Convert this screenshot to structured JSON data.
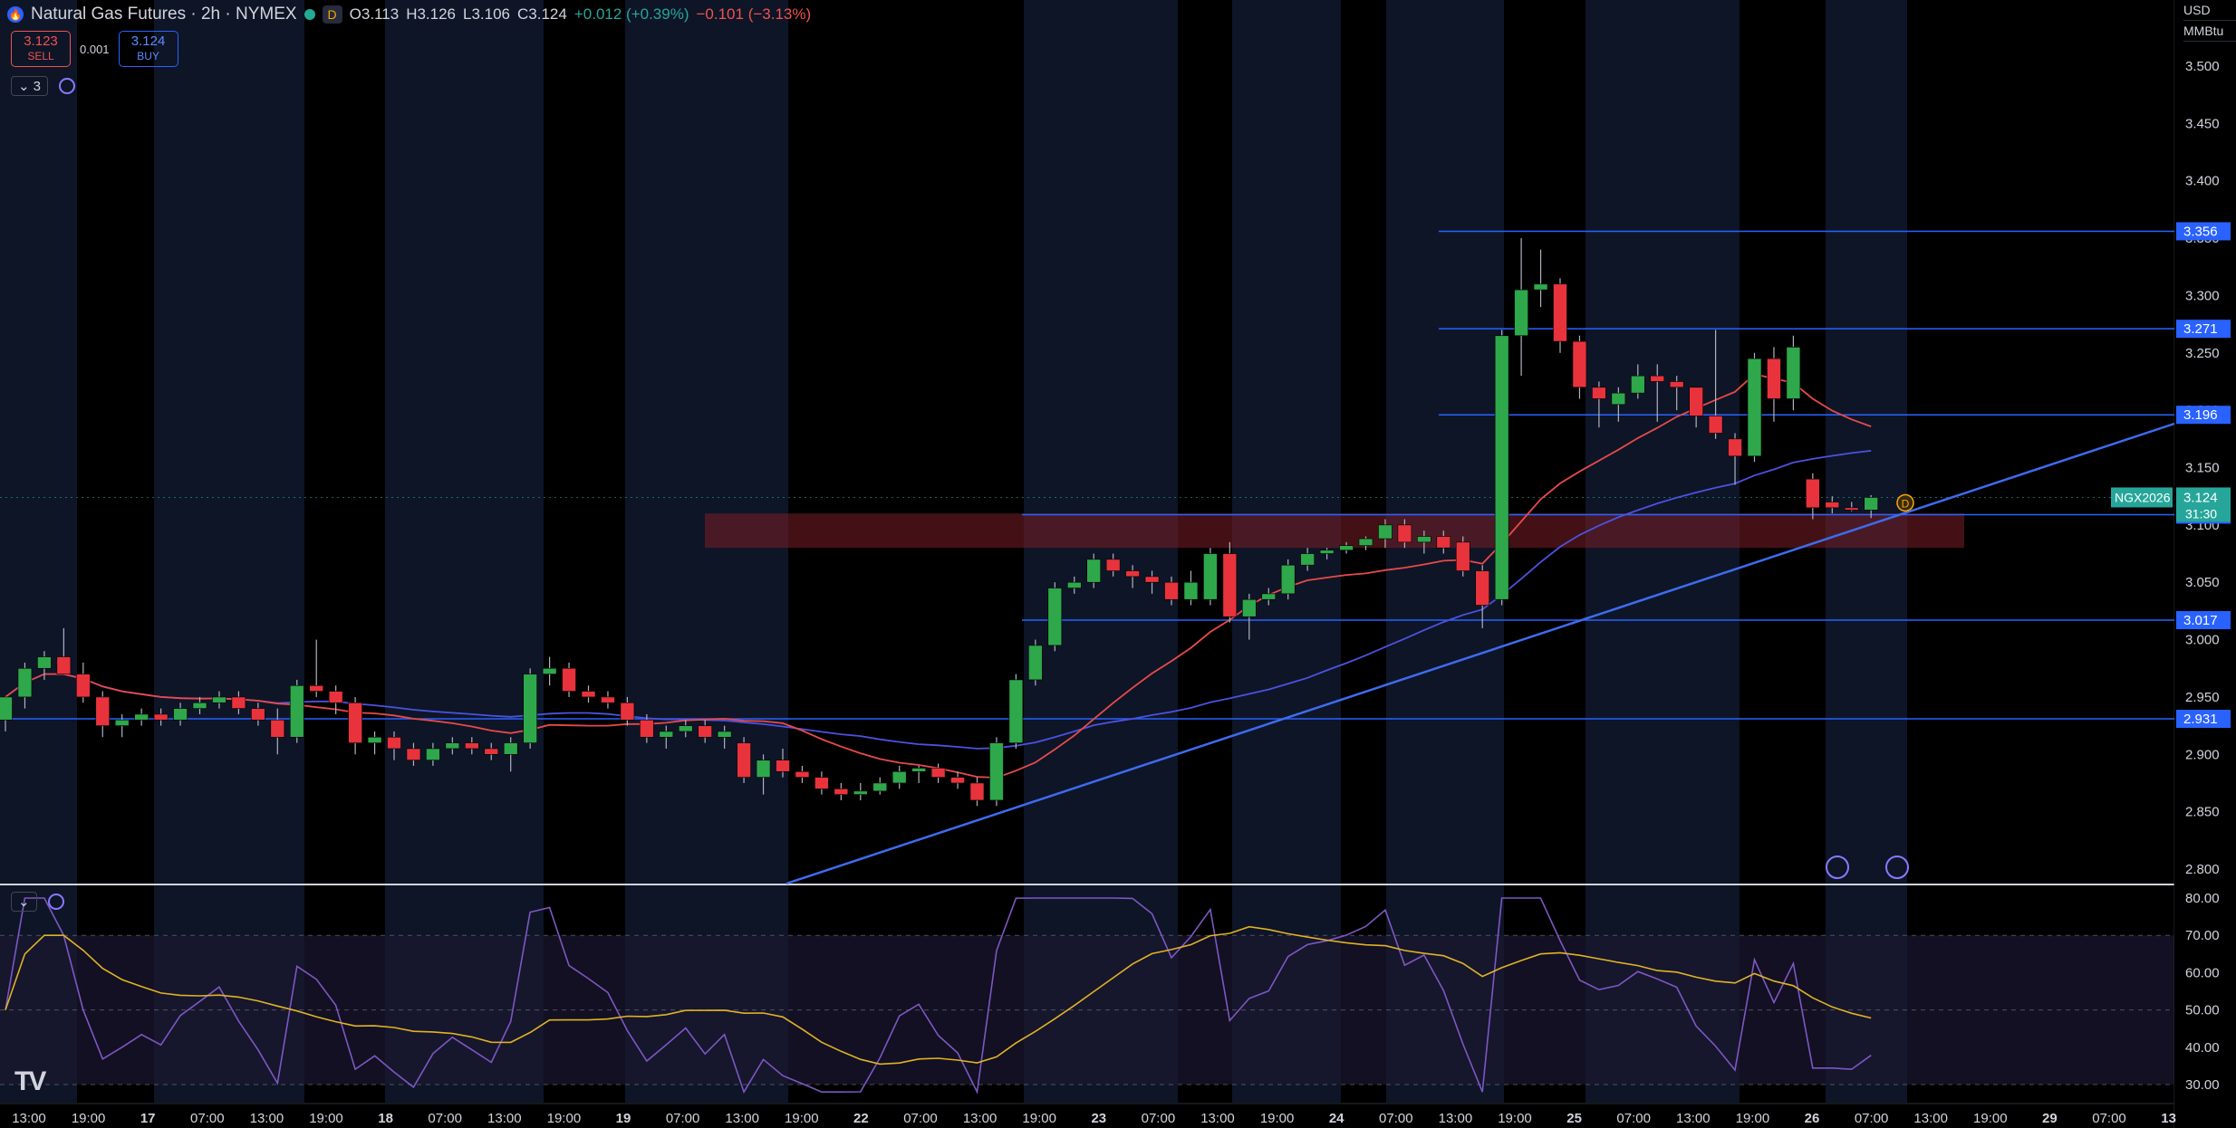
{
  "header": {
    "symbol_title": "Natural Gas Futures · 2h · NYMEX",
    "session_badge": "D",
    "ohlc": {
      "open": "O3.113",
      "high": "H3.126",
      "low": "L3.106",
      "close": "C3.124"
    },
    "change": "+0.012 (+0.39%)",
    "change_alt": "−0.101 (−3.13%)"
  },
  "trade": {
    "sell_price": "3.123",
    "sell_label": "SELL",
    "spread": "0.001",
    "buy_price": "3.124",
    "buy_label": "BUY"
  },
  "controls": {
    "indicators_count": "3"
  },
  "price_axis": {
    "currency": "USD",
    "unit": "MMBtu",
    "ticks": [
      "3.500",
      "3.450",
      "3.400",
      "3.350",
      "3.300",
      "3.250",
      "3.200",
      "3.150",
      "3.100",
      "3.050",
      "3.000",
      "2.950",
      "2.900",
      "2.850",
      "2.800"
    ]
  },
  "rsi_axis": {
    "ticks": [
      "80.00",
      "70.00",
      "60.00",
      "50.00",
      "40.00",
      "30.00"
    ]
  },
  "time_axis": {
    "labels": [
      "13:00",
      "19:00",
      "17",
      "07:00",
      "13:00",
      "19:00",
      "18",
      "07:00",
      "13:00",
      "19:00",
      "19",
      "07:00",
      "13:00",
      "19:00",
      "22",
      "07:00",
      "13:00",
      "19:00",
      "23",
      "07:00",
      "13:00",
      "19:00",
      "24",
      "07:00",
      "13:00",
      "19:00",
      "25",
      "07:00",
      "13:00",
      "19:00",
      "26",
      "07:00",
      "13:00",
      "19:00",
      "29",
      "07:00",
      "13"
    ]
  },
  "levels": [
    {
      "price": 3.356,
      "label": "3.356"
    },
    {
      "price": 3.271,
      "label": "3.271"
    },
    {
      "price": 3.196,
      "label": "3.196"
    },
    {
      "price": 3.109,
      "label": "3.109"
    },
    {
      "price": 3.017,
      "label": "3.017"
    },
    {
      "price": 2.931,
      "label": "2.931"
    }
  ],
  "last_price": {
    "ticker": "NGX2026",
    "price": "3.124",
    "countdown": "31:30"
  },
  "colors": {
    "up": "#26a69a",
    "up_body": "#2ea84a",
    "down": "#ef5350",
    "level": "#2962ff",
    "ma_fast": "#e84a4a",
    "ma_slow": "#4c52e0",
    "rsi": "#7e57c2",
    "rsi_ma": "#e0b325"
  },
  "chart_data": {
    "type": "candlestick",
    "timeframe": "2h",
    "y_range": [
      2.79,
      3.53
    ],
    "rsi_range": [
      25,
      82
    ],
    "candles": [
      [
        2.93,
        2.95,
        2.92,
        2.95
      ],
      [
        2.95,
        2.98,
        2.94,
        2.975
      ],
      [
        2.975,
        2.99,
        2.965,
        2.985
      ],
      [
        2.985,
        3.01,
        2.97,
        2.97
      ],
      [
        2.97,
        2.98,
        2.945,
        2.95
      ],
      [
        2.95,
        2.955,
        2.915,
        2.925
      ],
      [
        2.925,
        2.935,
        2.915,
        2.93
      ],
      [
        2.93,
        2.94,
        2.925,
        2.935
      ],
      [
        2.935,
        2.94,
        2.925,
        2.93
      ],
      [
        2.93,
        2.945,
        2.925,
        2.94
      ],
      [
        2.94,
        2.95,
        2.935,
        2.945
      ],
      [
        2.945,
        2.955,
        2.94,
        2.95
      ],
      [
        2.95,
        2.955,
        2.935,
        2.94
      ],
      [
        2.94,
        2.945,
        2.925,
        2.93
      ],
      [
        2.93,
        2.94,
        2.9,
        2.915
      ],
      [
        2.915,
        2.965,
        2.91,
        2.96
      ],
      [
        2.96,
        3.0,
        2.95,
        2.955
      ],
      [
        2.955,
        2.96,
        2.935,
        2.945
      ],
      [
        2.945,
        2.95,
        2.9,
        2.91
      ],
      [
        2.91,
        2.92,
        2.9,
        2.915
      ],
      [
        2.915,
        2.92,
        2.895,
        2.905
      ],
      [
        2.905,
        2.91,
        2.89,
        2.895
      ],
      [
        2.895,
        2.91,
        2.89,
        2.905
      ],
      [
        2.905,
        2.915,
        2.9,
        2.91
      ],
      [
        2.91,
        2.915,
        2.9,
        2.905
      ],
      [
        2.905,
        2.91,
        2.895,
        2.9
      ],
      [
        2.9,
        2.915,
        2.885,
        2.91
      ],
      [
        2.91,
        2.975,
        2.905,
        2.97
      ],
      [
        2.97,
        2.985,
        2.96,
        2.975
      ],
      [
        2.975,
        2.98,
        2.95,
        2.955
      ],
      [
        2.955,
        2.96,
        2.945,
        2.95
      ],
      [
        2.95,
        2.955,
        2.94,
        2.945
      ],
      [
        2.945,
        2.95,
        2.925,
        2.93
      ],
      [
        2.93,
        2.935,
        2.91,
        2.915
      ],
      [
        2.915,
        2.925,
        2.905,
        2.92
      ],
      [
        2.92,
        2.93,
        2.915,
        2.925
      ],
      [
        2.925,
        2.93,
        2.91,
        2.915
      ],
      [
        2.915,
        2.925,
        2.905,
        2.92
      ],
      [
        2.91,
        2.915,
        2.875,
        2.88
      ],
      [
        2.88,
        2.9,
        2.865,
        2.895
      ],
      [
        2.895,
        2.905,
        2.88,
        2.885
      ],
      [
        2.885,
        2.89,
        2.875,
        2.88
      ],
      [
        2.88,
        2.885,
        2.865,
        2.87
      ],
      [
        2.87,
        2.875,
        2.86,
        2.865
      ],
      [
        2.865,
        2.875,
        2.86,
        2.868
      ],
      [
        2.868,
        2.88,
        2.865,
        2.875
      ],
      [
        2.875,
        2.89,
        2.87,
        2.885
      ],
      [
        2.885,
        2.89,
        2.875,
        2.888
      ],
      [
        2.888,
        2.892,
        2.875,
        2.88
      ],
      [
        2.88,
        2.885,
        2.87,
        2.875
      ],
      [
        2.875,
        2.88,
        2.855,
        2.86
      ],
      [
        2.86,
        2.915,
        2.855,
        2.91
      ],
      [
        2.91,
        2.97,
        2.905,
        2.965
      ],
      [
        2.965,
        3.0,
        2.96,
        2.995
      ],
      [
        2.995,
        3.05,
        2.99,
        3.045
      ],
      [
        3.045,
        3.055,
        3.04,
        3.05
      ],
      [
        3.05,
        3.075,
        3.045,
        3.07
      ],
      [
        3.07,
        3.075,
        3.055,
        3.06
      ],
      [
        3.06,
        3.065,
        3.045,
        3.055
      ],
      [
        3.055,
        3.06,
        3.04,
        3.05
      ],
      [
        3.05,
        3.055,
        3.03,
        3.035
      ],
      [
        3.035,
        3.06,
        3.03,
        3.05
      ],
      [
        3.035,
        3.08,
        3.03,
        3.075
      ],
      [
        3.075,
        3.085,
        3.015,
        3.02
      ],
      [
        3.02,
        3.04,
        3.0,
        3.035
      ],
      [
        3.035,
        3.045,
        3.03,
        3.04
      ],
      [
        3.04,
        3.07,
        3.035,
        3.065
      ],
      [
        3.065,
        3.08,
        3.06,
        3.075
      ],
      [
        3.075,
        3.08,
        3.07,
        3.078
      ],
      [
        3.078,
        3.085,
        3.075,
        3.082
      ],
      [
        3.082,
        3.09,
        3.078,
        3.088
      ],
      [
        3.088,
        3.105,
        3.08,
        3.1
      ],
      [
        3.1,
        3.105,
        3.08,
        3.085
      ],
      [
        3.085,
        3.095,
        3.075,
        3.09
      ],
      [
        3.09,
        3.095,
        3.075,
        3.08
      ],
      [
        3.085,
        3.09,
        3.055,
        3.06
      ],
      [
        3.06,
        3.065,
        3.01,
        3.03
      ],
      [
        3.035,
        3.27,
        3.03,
        3.265
      ],
      [
        3.265,
        3.35,
        3.23,
        3.305
      ],
      [
        3.305,
        3.34,
        3.29,
        3.31
      ],
      [
        3.31,
        3.315,
        3.25,
        3.26
      ],
      [
        3.26,
        3.265,
        3.21,
        3.22
      ],
      [
        3.22,
        3.225,
        3.185,
        3.21
      ],
      [
        3.205,
        3.22,
        3.19,
        3.215
      ],
      [
        3.215,
        3.24,
        3.21,
        3.23
      ],
      [
        3.23,
        3.24,
        3.19,
        3.225
      ],
      [
        3.225,
        3.23,
        3.2,
        3.22
      ],
      [
        3.22,
        3.22,
        3.185,
        3.195
      ],
      [
        3.195,
        3.27,
        3.175,
        3.18
      ],
      [
        3.175,
        3.18,
        3.135,
        3.16
      ],
      [
        3.16,
        3.25,
        3.155,
        3.245
      ],
      [
        3.245,
        3.255,
        3.19,
        3.21
      ],
      [
        3.21,
        3.265,
        3.2,
        3.255
      ],
      [
        3.14,
        3.145,
        3.105,
        3.115
      ],
      [
        3.12,
        3.125,
        3.11,
        3.115
      ],
      [
        3.115,
        3.12,
        3.112,
        3.113
      ],
      [
        3.113,
        3.126,
        3.106,
        3.124
      ]
    ]
  }
}
